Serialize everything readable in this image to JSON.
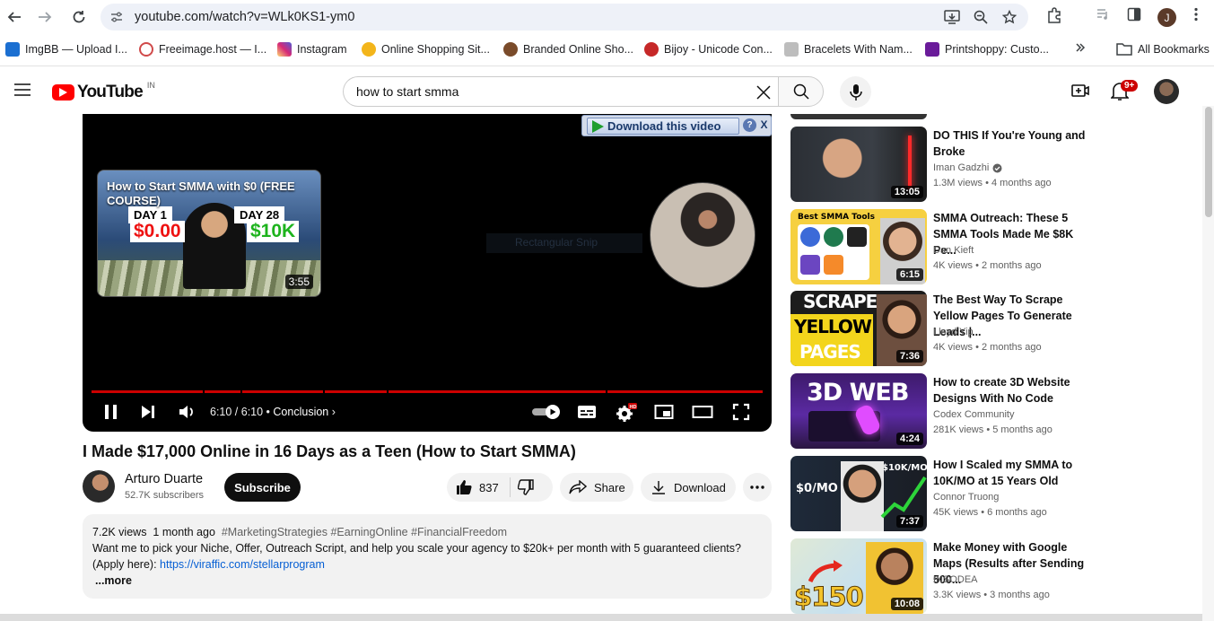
{
  "browser": {
    "url": "youtube.com/watch?v=WLk0KS1-ym0",
    "profile_initial": "J",
    "bookmarks": [
      {
        "label": "ImgBB — Upload I...",
        "color": "#1b6fd1"
      },
      {
        "label": "Freeimage.host — I...",
        "color": "#d04a4a"
      },
      {
        "label": "Instagram",
        "color": "#d62976"
      },
      {
        "label": "Online Shopping Sit...",
        "color": "#f3b51b"
      },
      {
        "label": "Branded Online Sho...",
        "color": "#7a4b2a"
      },
      {
        "label": "Bijoy - Unicode Con...",
        "color": "#c62828"
      },
      {
        "label": "Bracelets With Nam...",
        "color": "#9e9e9e"
      },
      {
        "label": "Printshoppy: Custo...",
        "color": "#6a1b9a"
      }
    ],
    "all_bookmarks": "All Bookmarks"
  },
  "youtube": {
    "logo_text": "YouTube",
    "country_code": "IN",
    "search_query": "how to start smma",
    "notification_count": "9+"
  },
  "player": {
    "download_bar_label": "Download this video",
    "help_glyph": "?",
    "close_glyph": "X",
    "end_card": {
      "title": "How to Start SMMA with $0 (FREE COURSE)",
      "day_left": "DAY 1",
      "day_right": "DAY 28",
      "amount_left": "$0.00",
      "amount_right": "$10K",
      "duration": "3:55"
    },
    "snip_hint": "Rectangular Snip",
    "time": "6:10 / 6:10",
    "chapter": "Conclusion",
    "progress_fraction": 1.0
  },
  "video": {
    "title": "I Made $17,000 Online in 16 Days as a Teen (How to Start SMMA)",
    "channel_name": "Arturo Duarte",
    "subscribers": "52.7K subscribers",
    "subscribe_label": "Subscribe",
    "likes": "837",
    "share_label": "Share",
    "download_label": "Download",
    "description": {
      "views": "7.2K views",
      "age": "1 month ago",
      "tags": "#MarketingStrategies #EarningOnline #FinancialFreedom",
      "body": "Want me to pick your Niche, Offer, Outreach Script, and help you scale your agency to $20k+ per month with 5 guaranteed clients?",
      "apply_prefix": "(Apply here):",
      "link": "https://viraffic.com/stellarprogram",
      "more": "...more"
    }
  },
  "recommendations": [
    {
      "title": "DO THIS If You're Young and Broke",
      "channel": "Iman Gadzhi",
      "verified": true,
      "views": "1.3M views",
      "age": "4 months ago",
      "duration": "13:05"
    },
    {
      "title": "SMMA Outreach: These 5 SMMA Tools Made Me $8K Pe...",
      "channel": "Dan Kieft",
      "verified": false,
      "views": "4K views",
      "age": "2 months ago",
      "duration": "6:15",
      "thumb_label": "Best SMMA Tools"
    },
    {
      "title": "The Best Way To Scrape Yellow Pages To Generate Leads |...",
      "channel": "Lloyd Yip",
      "verified": false,
      "views": "4K views",
      "age": "2 months ago",
      "duration": "7:36",
      "thumb_lines": [
        "SCRAPE",
        "YELLOW",
        "PAGES"
      ]
    },
    {
      "title": "How to create 3D Website Designs With No Code",
      "channel": "Codex Community",
      "verified": false,
      "views": "281K views",
      "age": "5 months ago",
      "duration": "4:24",
      "thumb_label": "3D WEB"
    },
    {
      "title": "How I Scaled my SMMA to 10K/MO at 15 Years Old",
      "channel": "Connor Truong",
      "verified": false,
      "views": "45K views",
      "age": "6 months ago",
      "duration": "7:37",
      "thumb_left": "$0/MO",
      "thumb_right": "$10K/MO"
    },
    {
      "title": "Make Money with Google Maps (Results after Sending 500...",
      "channel": "INSODEA",
      "verified": false,
      "views": "3.3K views",
      "age": "3 months ago",
      "duration": "10:08",
      "thumb_label": "$150"
    }
  ],
  "colors": {
    "youtube_red": "#ff0000",
    "progress_red": "#cc0000",
    "link_blue": "#065fd4"
  }
}
